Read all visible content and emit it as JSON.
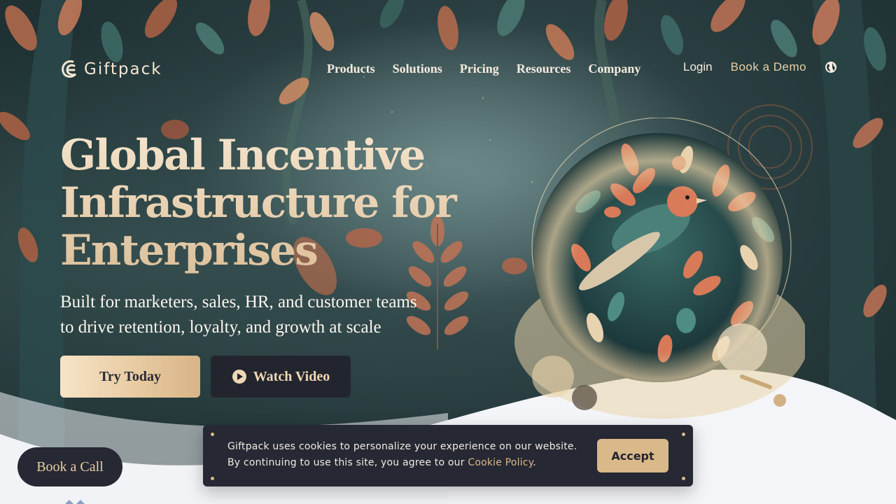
{
  "header": {
    "logo_text": "Giftpack",
    "nav": [
      "Products",
      "Solutions",
      "Pricing",
      "Resources",
      "Company"
    ],
    "login_label": "Login",
    "demo_label": "Book a Demo",
    "globe_icon": "globe-icon"
  },
  "hero": {
    "title_line1": "Global Incentive",
    "title_line2": "Infrastructure for",
    "title_line3": "Enterprises",
    "subtitle_line1": "Built for marketers, sales, HR, and customer teams",
    "subtitle_line2": "to drive retention, loyalty, and growth at scale",
    "try_label": "Try Today",
    "watch_label": "Watch Video",
    "play_icon": "play-icon"
  },
  "cookie": {
    "line1": "Giftpack uses cookies to personalize your experience on our website.",
    "line2_prefix": "By continuing to use this site, you agree to our ",
    "link_label": "Cookie Policy",
    "line2_suffix": ".",
    "accept_label": "Accept"
  },
  "floating": {
    "call_label": "Book a Call"
  },
  "colors": {
    "accent_gold": "#d9b98a",
    "dark": "#262833",
    "cream": "#f4e4cc"
  }
}
